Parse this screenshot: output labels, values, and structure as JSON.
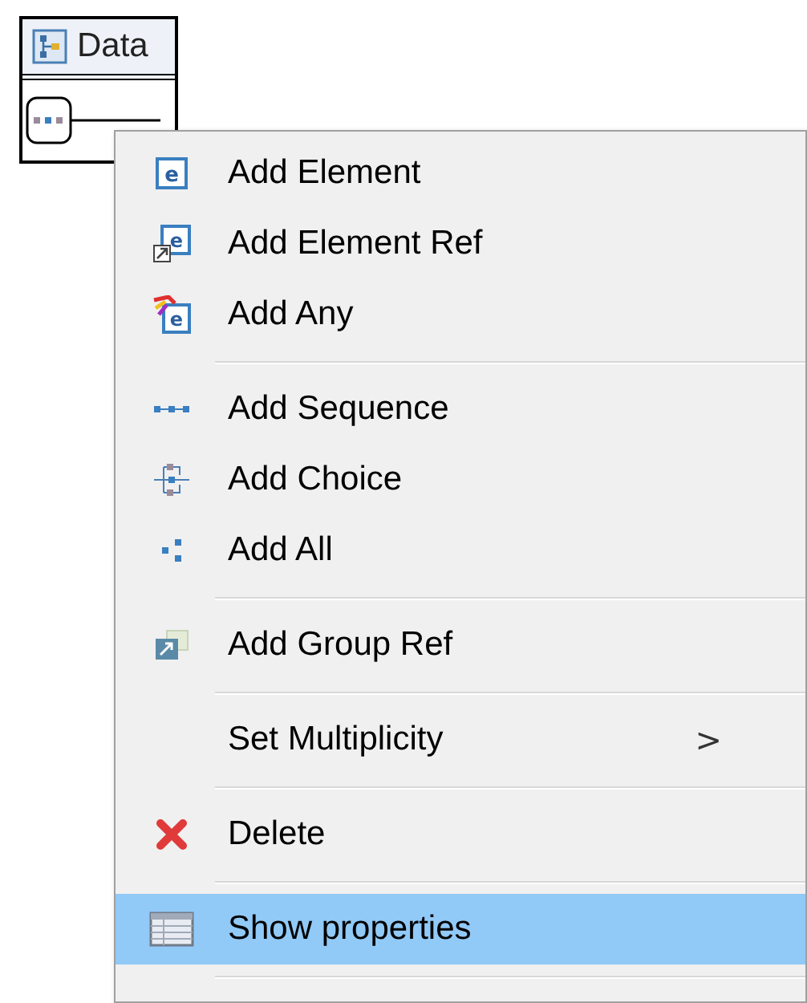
{
  "diagram": {
    "title": "Data"
  },
  "context_menu": {
    "items": [
      {
        "kind": "item",
        "label": "Add Element",
        "selected": false,
        "icon_text": "e"
      },
      {
        "kind": "item",
        "label": "Add Element Ref",
        "selected": false,
        "icon_text": "e"
      },
      {
        "kind": "item",
        "label": "Add Any",
        "selected": false,
        "icon_text": "e"
      },
      {
        "kind": "separator"
      },
      {
        "kind": "item",
        "label": "Add Sequence",
        "selected": false
      },
      {
        "kind": "item",
        "label": "Add Choice",
        "selected": false
      },
      {
        "kind": "item",
        "label": "Add All",
        "selected": false
      },
      {
        "kind": "separator"
      },
      {
        "kind": "item",
        "label": "Add Group Ref",
        "selected": false
      },
      {
        "kind": "separator"
      },
      {
        "kind": "item",
        "label": "Set Multiplicity",
        "selected": false,
        "submenu_arrow": ">"
      },
      {
        "kind": "separator"
      },
      {
        "kind": "item",
        "label": "Delete",
        "selected": false
      },
      {
        "kind": "separator"
      },
      {
        "kind": "item",
        "label": "Show properties",
        "selected": true
      },
      {
        "kind": "separator"
      }
    ]
  }
}
